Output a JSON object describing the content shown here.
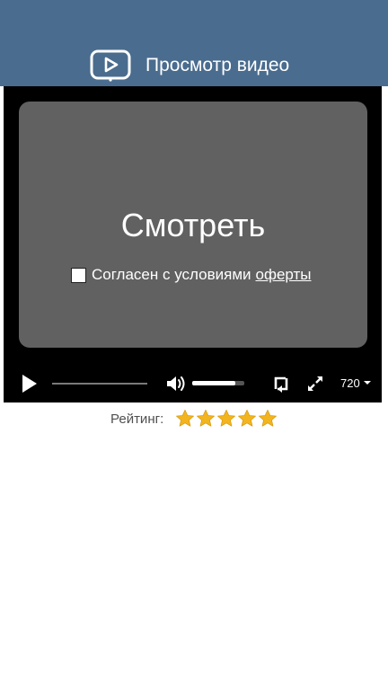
{
  "header": {
    "title": "Просмотр видео",
    "logo_icon": "video-play-icon",
    "background_color": "#4a6c8e"
  },
  "player": {
    "overlay": {
      "watch_label": "Смотреть",
      "consent_text": "Согласен с условиями",
      "consent_link": "оферты",
      "consent_checked": false,
      "panel_color": "#616161"
    },
    "controls": {
      "play_icon": "play-icon",
      "progress_fraction": 0.0,
      "volume_icon": "volume-icon",
      "volume_fraction": 0.82,
      "loop_icon": "loop-icon",
      "fullscreen_icon": "fullscreen-icon",
      "quality": "720"
    }
  },
  "rating": {
    "label": "Рейтинг:",
    "value": 5,
    "max": 5,
    "star_color": "#f2b51f"
  }
}
